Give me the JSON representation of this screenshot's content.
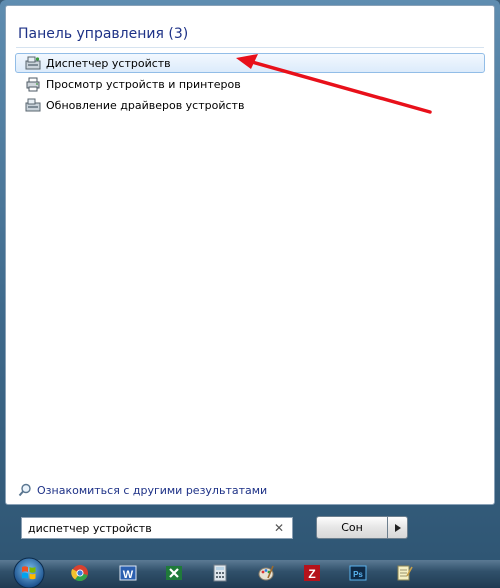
{
  "results": {
    "group_header": "Панель управления (3)",
    "items": [
      {
        "label": "Диспетчер устройств",
        "icon": "device-manager-icon",
        "selected": true
      },
      {
        "label": "Просмотр устройств и принтеров",
        "icon": "devices-printers-icon",
        "selected": false
      },
      {
        "label": "Обновление драйверов устройств",
        "icon": "driver-update-icon",
        "selected": false
      }
    ],
    "more_results": "Ознакомиться с другими результатами"
  },
  "search": {
    "value": "диспетчер устройств",
    "clear_icon": "close-icon"
  },
  "power": {
    "button_label": "Сон",
    "options_icon": "chevron-right-icon"
  },
  "taskbar": {
    "start_icon": "windows-start-icon",
    "apps": [
      {
        "icon": "chrome-icon"
      },
      {
        "icon": "word-icon"
      },
      {
        "icon": "excel-icon"
      },
      {
        "icon": "calculator-icon"
      },
      {
        "icon": "paint-icon"
      },
      {
        "icon": "filezilla-icon"
      },
      {
        "icon": "photoshop-icon"
      },
      {
        "icon": "notepad-icon"
      }
    ]
  },
  "colors": {
    "accent_header": "#1e3287",
    "selection_border": "#92bde7",
    "annotation_arrow": "#e8101a"
  }
}
